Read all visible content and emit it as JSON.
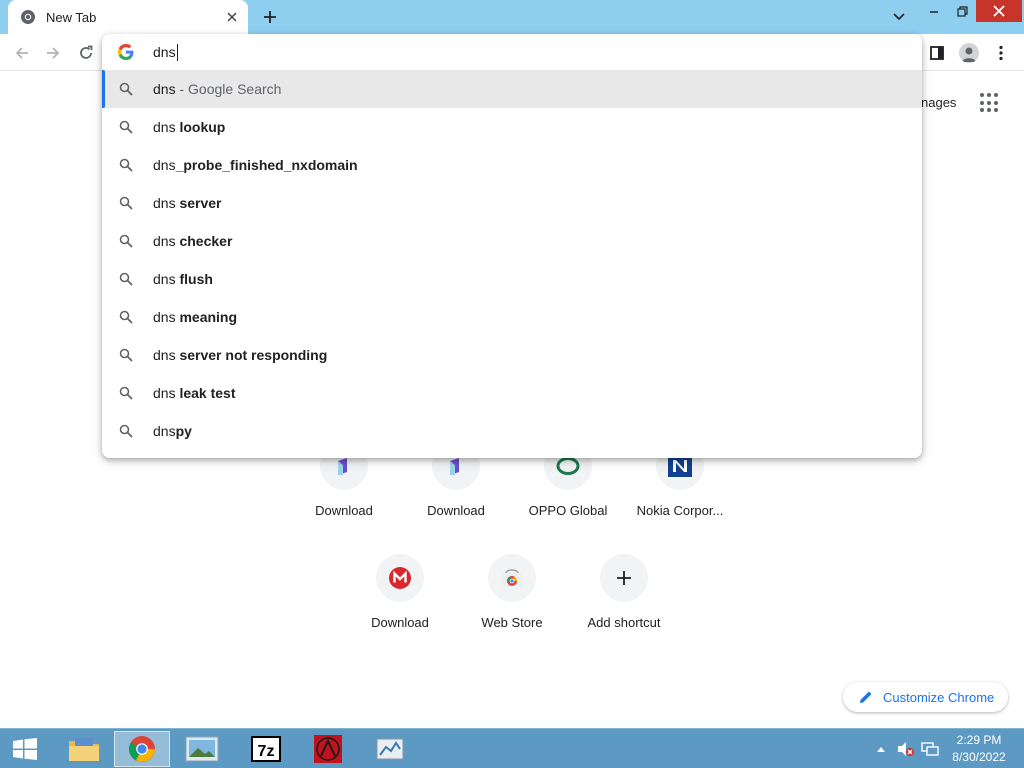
{
  "browser": {
    "tab_title": "New Tab",
    "omnibox_value": "dns"
  },
  "suggestions": [
    {
      "prefix": "dns",
      "bold": "",
      "sep": " - ",
      "suffix": "Google Search",
      "selected": true
    },
    {
      "prefix": "dns ",
      "bold": "lookup"
    },
    {
      "prefix": "dns",
      "bold": "_probe_finished_nxdomain"
    },
    {
      "prefix": "dns ",
      "bold": "server"
    },
    {
      "prefix": "dns ",
      "bold": "checker"
    },
    {
      "prefix": "dns ",
      "bold": "flush"
    },
    {
      "prefix": "dns ",
      "bold": "meaning"
    },
    {
      "prefix": "dns ",
      "bold": "server not responding"
    },
    {
      "prefix": "dns ",
      "bold": "leak test"
    },
    {
      "prefix": "dns",
      "bold": "py"
    }
  ],
  "ntp": {
    "images_link": "nages",
    "shortcuts": [
      {
        "label": "Download",
        "icon": "notion-like-icon"
      },
      {
        "label": "Download",
        "icon": "notion-like-icon"
      },
      {
        "label": "OPPO Global",
        "icon": "oppo-icon"
      },
      {
        "label": "Nokia Corpor...",
        "icon": "nokia-icon"
      },
      {
        "label": "Download",
        "icon": "mega-icon"
      },
      {
        "label": "Web Store",
        "icon": "web-store-icon"
      },
      {
        "label": "Add shortcut",
        "icon": "plus-icon"
      }
    ],
    "customize_label": "Customize Chrome"
  },
  "taskbar": {
    "time": "2:29 PM",
    "date": "8/30/2022",
    "apps": [
      "file-explorer-icon",
      "chrome-icon",
      "photo-viewer-icon",
      "7zip-icon",
      "autocad-icon",
      "control-panel-icon"
    ]
  },
  "colors": {
    "tabstrip": "#8ecff0",
    "accent": "#1a73e8",
    "taskbar": "#5c9ac4"
  }
}
